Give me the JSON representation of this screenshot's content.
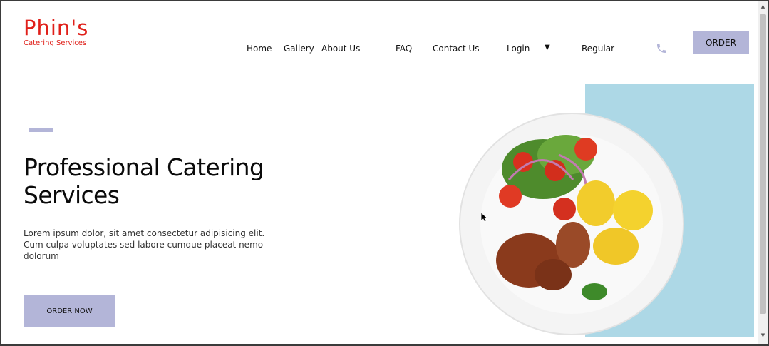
{
  "brand": {
    "name": "Phin's",
    "tagline": "Catering Services",
    "accent_color": "#e0201a"
  },
  "nav": {
    "items": [
      {
        "label": "Home"
      },
      {
        "label": "Gallery"
      },
      {
        "label": "About Us"
      },
      {
        "label": "FAQ"
      },
      {
        "label": "Contact Us"
      },
      {
        "label": "Login"
      },
      {
        "label": "Regular"
      }
    ],
    "dropdown_icon": "caret-down-icon",
    "phone_icon": "phone-icon",
    "order_label": "ORDER"
  },
  "hero": {
    "title": "Professional Catering Services",
    "text": "Lorem ipsum dolor, sit amet consectetur adipisicing elit. Cum culpa voluptates sed labore cumque placeat nemo dolorum",
    "cta_label": "ORDER NOW",
    "image": "plate-of-grilled-meat-potatoes-and-salad"
  },
  "colors": {
    "button": "#b3b5d8",
    "panel": "#add8e6"
  }
}
